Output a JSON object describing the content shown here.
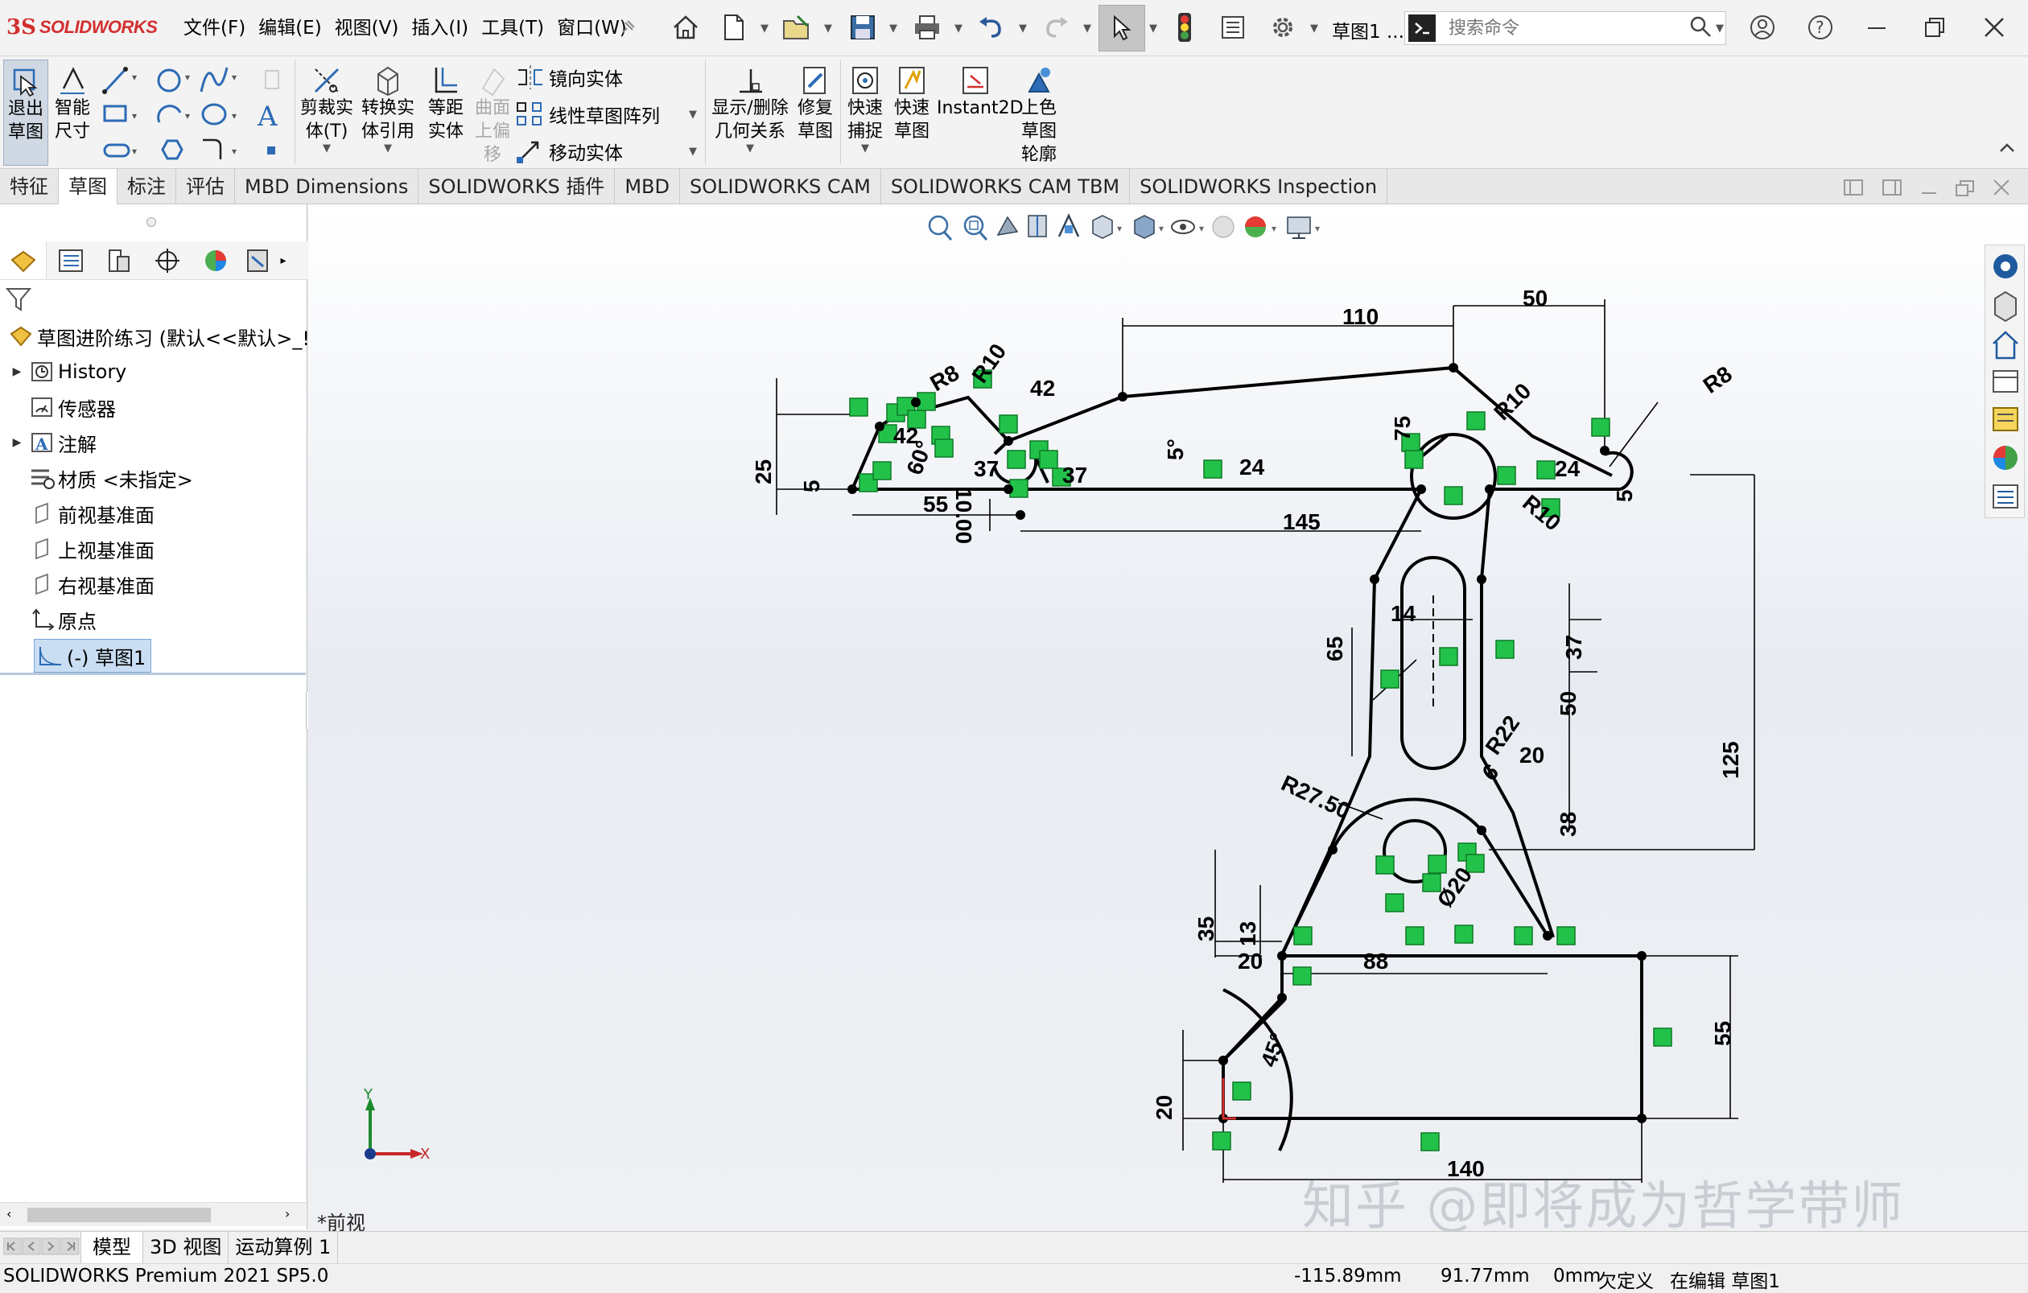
{
  "app": {
    "brand_ds": "3S",
    "brand_name": "SOLIDWORKS",
    "menus": [
      "文件(F)",
      "编辑(E)",
      "视图(V)",
      "插入(I)",
      "工具(T)",
      "窗口(W)"
    ],
    "doc_title": "草图1 ...",
    "search_placeholder": "搜索命令"
  },
  "commands": {
    "exit_sketch": [
      "退出",
      "草图"
    ],
    "smart_dim": [
      "智能",
      "尺寸"
    ],
    "trim": [
      "剪裁实",
      "体(T)"
    ],
    "convert": [
      "转换实",
      "体引用"
    ],
    "offset": [
      "等距",
      "实体"
    ],
    "surface_offset": [
      "曲面",
      "上偏",
      "移"
    ],
    "mirror": "镜向实体",
    "linear_pattern": "线性草图阵列",
    "move": "移动实体",
    "display_relations": [
      "显示/删除",
      "几何关系"
    ],
    "repair": [
      "修复",
      "草图"
    ],
    "quick_snap": [
      "快速",
      "捕捉"
    ],
    "rapid_sketch": [
      "快速",
      "草图"
    ],
    "instant2d": "Instant2D",
    "shaded_contour": [
      "上色",
      "草图",
      "轮廓"
    ]
  },
  "tabs": [
    "特征",
    "草图",
    "标注",
    "评估",
    "MBD Dimensions",
    "SOLIDWORKS 插件",
    "MBD",
    "SOLIDWORKS CAM",
    "SOLIDWORKS CAM TBM",
    "SOLIDWORKS Inspection"
  ],
  "active_tab": "草图",
  "tree": {
    "root": "草图进阶练习  (默认<<默认>_!",
    "items": [
      "History",
      "传感器",
      "注解",
      "材质 <未指定>",
      "前视基准面",
      "上视基准面",
      "右视基准面",
      "原点",
      "(-) 草图1"
    ]
  },
  "bottom_tabs": [
    "模型",
    "3D 视图",
    "运动算例 1"
  ],
  "view_label": "*前视",
  "triad": {
    "x": "X",
    "y": "Y"
  },
  "status": {
    "product": "SOLIDWORKS Premium 2021 SP5.0",
    "x": "-115.89mm",
    "y": "91.77mm",
    "z": "0mm",
    "definition": "欠定义",
    "mode": "在编辑 草图1"
  },
  "watermark": "知乎 @即将成为哲学带师",
  "dims": {
    "d110": "110",
    "d50": "50",
    "r8a": "R8",
    "r10a": "R10",
    "d42a": "42",
    "d42b": "42",
    "d25": "25",
    "d5a": "5",
    "d60": "60°",
    "d10": "10.00",
    "d37a": "37",
    "d37b": "37",
    "d5deg": "5°",
    "d24a": "24",
    "d24b": "24",
    "d55a": "55",
    "d145": "145",
    "d75": "75",
    "r10b": "R10",
    "r8b": "R8",
    "r10c": "R10",
    "d5b": "5",
    "d14": "14",
    "d65": "65",
    "d37c": "37",
    "d50b": "50",
    "d125": "125",
    "r27": "R27.50",
    "r22": "R22",
    "d20a": "20",
    "d6": "6",
    "d38": "38",
    "phi20": "Ø20",
    "d35": "35",
    "d13": "13",
    "d20b": "20",
    "d88": "88",
    "d55b": "55",
    "d45": "45°",
    "d20c": "20",
    "d140": "140"
  }
}
